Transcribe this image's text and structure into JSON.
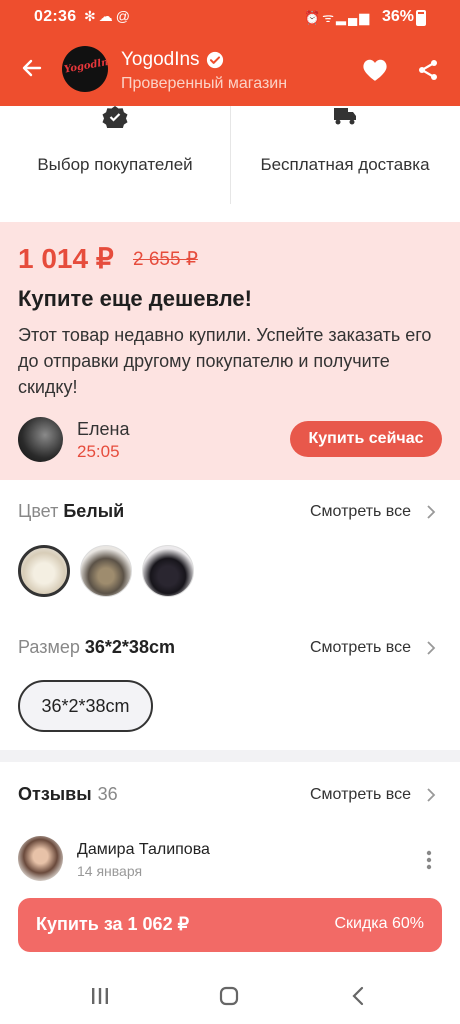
{
  "status_bar": {
    "time": "02:36",
    "left_icons": "✻☁@",
    "right_icons": "⏰ᯤ▂▄▆",
    "battery": "36%"
  },
  "header": {
    "shop_logo_text": "Yogodlns",
    "shop_name": "YogodIns",
    "shop_subtitle": "Проверенный магазин"
  },
  "features": [
    {
      "icon": "verified-badge-icon",
      "label": "Выбор покупателей"
    },
    {
      "icon": "truck-icon",
      "label": "Бесплатная доставка"
    }
  ],
  "promo": {
    "price": "1 014 ₽",
    "old_price": "2 655 ₽",
    "title": "Купите еще дешевле!",
    "description": "Этот товар недавно купили. Успейте заказать его до отправки другому покупателю и получите скидку!",
    "buyer_name": "Елена",
    "timer": "25:05",
    "buy_now_label": "Купить сейчас"
  },
  "color": {
    "label": "Цвет",
    "value": "Белый",
    "see_all": "Смотреть все",
    "swatches": [
      "white",
      "gold-sequin",
      "black-sequin"
    ]
  },
  "size": {
    "label": "Размер",
    "value": "36*2*38cm",
    "see_all": "Смотреть все",
    "options": [
      "36*2*38cm"
    ]
  },
  "reviews": {
    "label": "Отзывы",
    "count": "36",
    "see_all": "Смотреть все",
    "reviewer_name": "Дамира Талипова",
    "review_date": "14 января"
  },
  "buy_bar": {
    "label": "Купить за 1 062 ₽",
    "discount": "Скидка 60%"
  },
  "colors": {
    "accent": "#ee4e2e",
    "promo_bg": "#fde3e1",
    "price_red": "#e64c3c",
    "buy_button": "#f26a66"
  }
}
